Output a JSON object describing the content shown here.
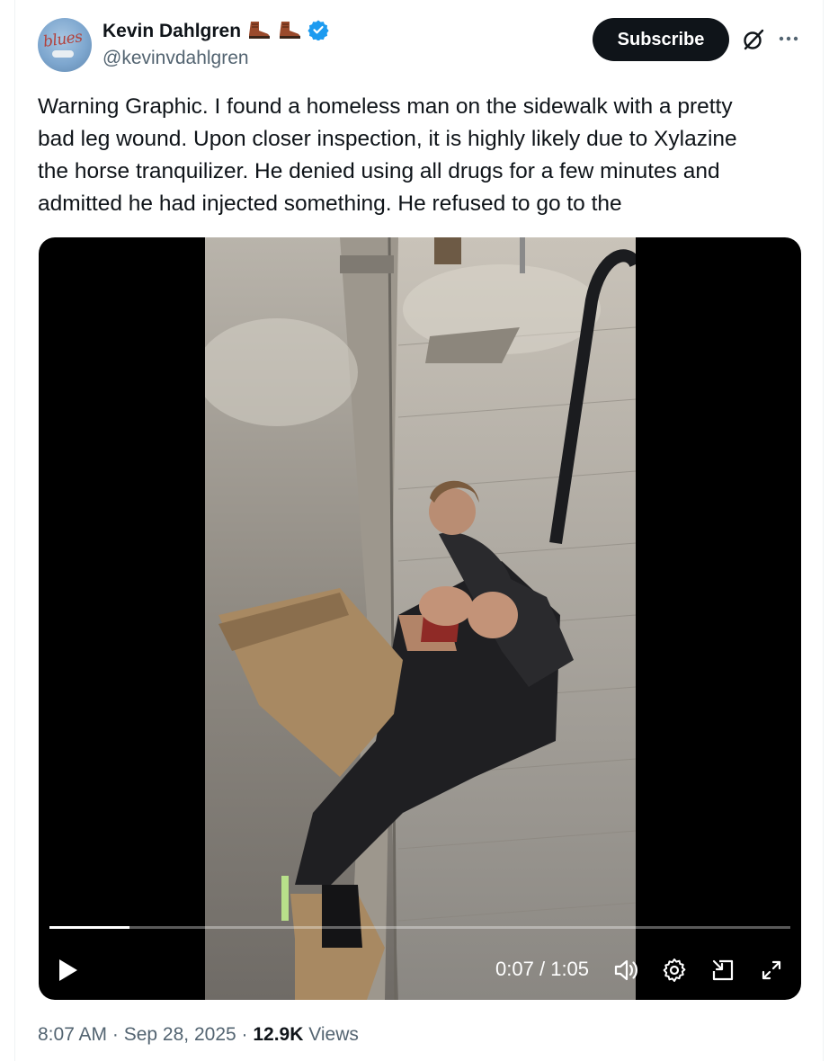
{
  "author": {
    "display_name": "Kevin Dahlgren",
    "handle": "@kevinvdahlgren",
    "avatar_text": "blues",
    "emoji_icons": [
      "boot-icon",
      "boot-icon"
    ],
    "verified_color": "#1d9bf0"
  },
  "actions": {
    "subscribe_label": "Subscribe",
    "grok_icon": "grok-icon",
    "more_icon": "more-icon"
  },
  "tweet": {
    "text": "Warning Graphic. I found a homeless man on the sidewalk with a pretty\nbad leg wound. Upon closer inspection, it is highly likely due to Xylazine\nthe horse tranquilizer. He denied using  all drugs for a few minutes and\nadmitted he had injected something. He refused to go to the"
  },
  "video": {
    "progress": 0.108,
    "current_time": "0:07",
    "separator": "/",
    "duration": "1:05",
    "controls": [
      "play-icon",
      "volume-icon",
      "settings-icon",
      "pip-icon",
      "fullscreen-icon"
    ]
  },
  "meta": {
    "time": "8:07 AM",
    "dot": " · ",
    "date": "Sep 28, 2025",
    "views_count": "12.9K",
    "views_label": " Views"
  },
  "colors": {
    "text_primary": "#0f1419",
    "text_secondary": "#536471",
    "button_bg": "#0f1419",
    "video_bg": "#000000"
  }
}
